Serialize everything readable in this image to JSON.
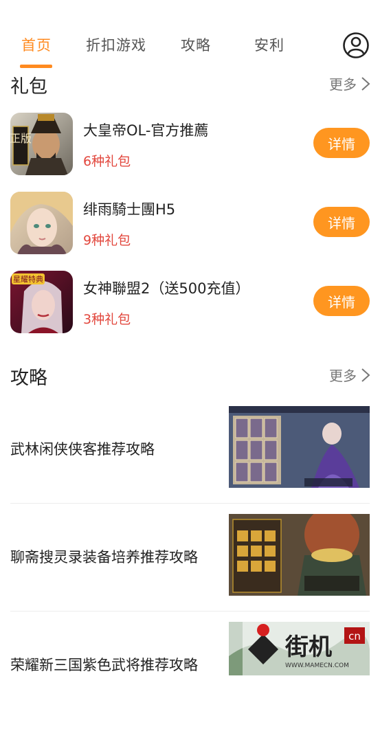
{
  "tabs": [
    {
      "label": "首页",
      "active": true
    },
    {
      "label": "折扣游戏",
      "active": false
    },
    {
      "label": "攻略",
      "active": false
    },
    {
      "label": "安利",
      "active": false
    }
  ],
  "gifts": {
    "title": "礼包",
    "more_label": "更多",
    "items": [
      {
        "name": "大皇帝OL-官方推薦",
        "count": "6种礼包",
        "button": "详情",
        "badge": "正版"
      },
      {
        "name": "绯雨騎士團H5",
        "count": "9种礼包",
        "button": "详情"
      },
      {
        "name": "女神聯盟2（送500充值）",
        "count": "3种礼包",
        "button": "详情",
        "badge": "星耀特典"
      }
    ]
  },
  "guides": {
    "title": "攻略",
    "more_label": "更多",
    "items": [
      {
        "title": "武林闲侠侠客推荐攻略"
      },
      {
        "title": "聊斋搜灵录装备培养推荐攻略"
      },
      {
        "title": "荣耀新三国紫色武将推荐攻略"
      }
    ]
  },
  "watermark": {
    "text": "街机",
    "domain": "cn",
    "url": "WWW.MAMECN.COM"
  },
  "colors": {
    "accent": "#ff8a1f",
    "button": "#ff9620",
    "gift_count": "#e2463c"
  }
}
